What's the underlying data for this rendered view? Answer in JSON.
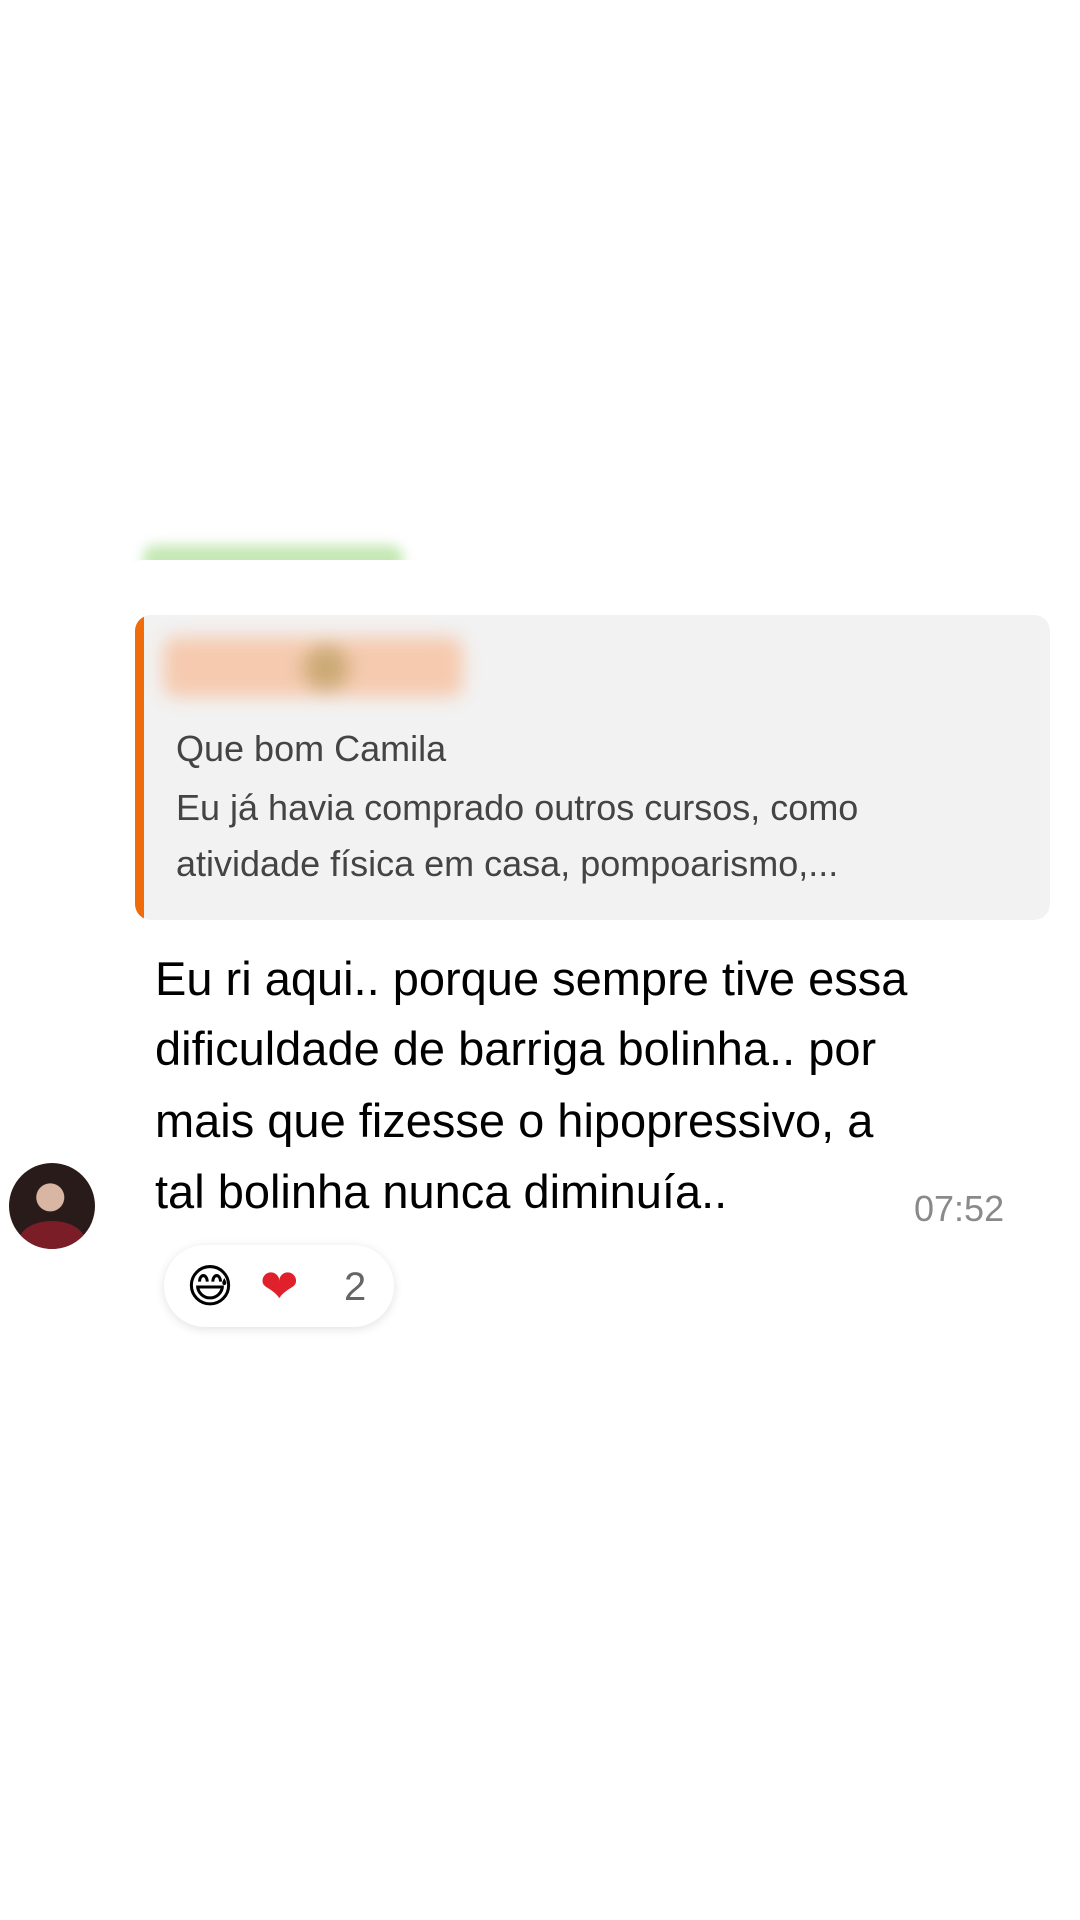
{
  "message": {
    "quote": {
      "title": "Que bom Camila",
      "lines": [
        "Eu já havia comprado outros cursos, como",
        "atividade física em casa, pompoarismo,..."
      ]
    },
    "text_lines": [
      "Eu ri aqui.. porque sempre tive essa",
      "dificuldade de barriga bolinha.. por",
      "mais que fizesse o hipopressivo, a",
      "tal bolinha nunca diminuía.."
    ],
    "time": "07:52",
    "reactions": {
      "emojis": [
        "😅",
        "❤"
      ],
      "count": "2"
    }
  },
  "colors": {
    "quote_accent": "#f06b0a",
    "quote_background": "#f2f2f2",
    "timestamp": "#8a8a8a"
  }
}
